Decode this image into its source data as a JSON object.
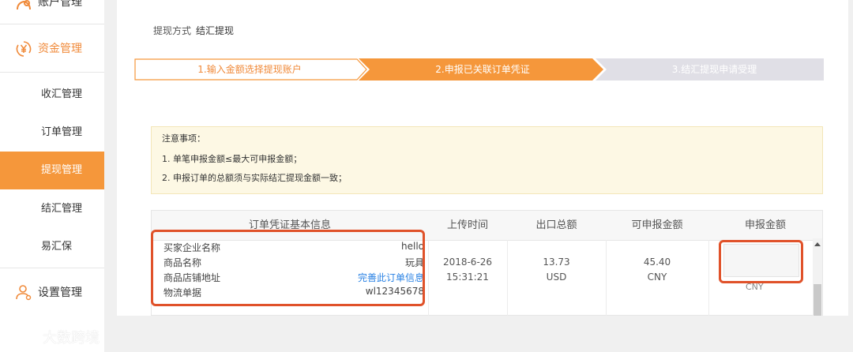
{
  "sidebar": {
    "top_label": "账户管理",
    "fund_label": "资金管理",
    "items": [
      {
        "label": "收汇管理"
      },
      {
        "label": "订单管理"
      },
      {
        "label": "提现管理"
      },
      {
        "label": "结汇管理"
      },
      {
        "label": "易汇保"
      }
    ],
    "settings_label": "设置管理",
    "active_item": "提现管理",
    "accent_color": "#f5973b"
  },
  "breadcrumb": {
    "label": "提现方式",
    "value": "结汇提现"
  },
  "steps": [
    {
      "label": "1.输入金额选择提现账户",
      "state": "done"
    },
    {
      "label": "2.申报已关联订单凭证",
      "state": "current"
    },
    {
      "label": "3.结汇提现申请受理",
      "state": "pending"
    }
  ],
  "notice": {
    "title": "注意事项：",
    "line1": "1. 单笔申报金额≤最大可申报金额；",
    "line2": "2. 申报订单的总额须与实际结汇提现金额一致；"
  },
  "table": {
    "headers": [
      "订单凭证基本信息",
      "上传时间",
      "出口总额",
      "可申报金额",
      "申报金额"
    ],
    "row": {
      "info": [
        {
          "key": "买家企业名称",
          "value": "hello"
        },
        {
          "key": "商品名称",
          "value": "玩具"
        },
        {
          "key": "商品店铺地址",
          "value": "完善此订单信息"
        },
        {
          "key": "物流单据",
          "value": "wl12345678"
        }
      ],
      "upload_date": "2018-6-26",
      "upload_time": "15:31:21",
      "export_amount": "13.73",
      "export_currency": "USD",
      "declarable_amount": "45.40",
      "declarable_currency": "CNY",
      "declare_currency": "CNY"
    }
  },
  "watermark": "大数跨境"
}
